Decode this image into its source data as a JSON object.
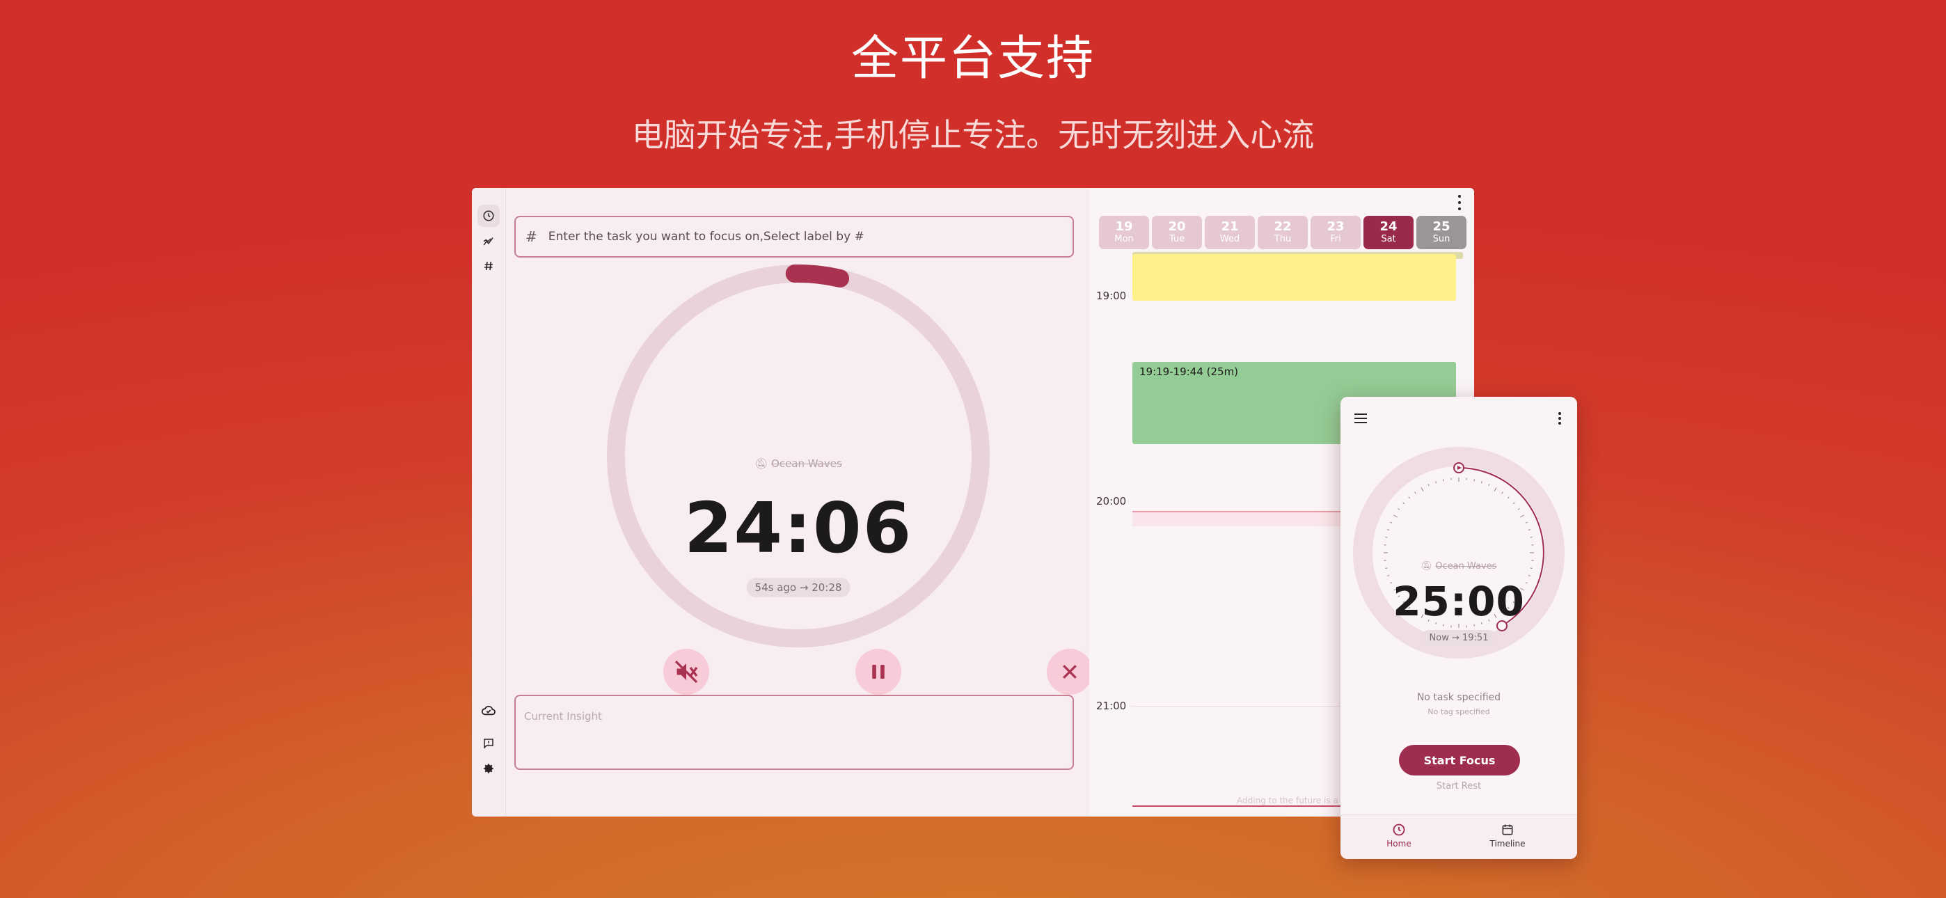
{
  "hero": {
    "title": "全平台支持",
    "subtitle": "电脑开始专注,手机停止专注。无时无刻进入心流"
  },
  "desktop": {
    "sidebar": {
      "items": [
        {
          "name": "timer",
          "icon": "clock-icon"
        },
        {
          "name": "stats",
          "icon": "chart-icon"
        },
        {
          "name": "tags",
          "icon": "hash-icon"
        }
      ],
      "bottom_items": [
        {
          "name": "sync",
          "icon": "cloud-icon"
        },
        {
          "name": "feedback",
          "icon": "feedback-icon"
        },
        {
          "name": "settings",
          "icon": "gear-icon"
        }
      ]
    },
    "task_input": {
      "placeholder": "Enter the task you want to focus on,Select label by #"
    },
    "timer": {
      "sound": "Ocean Waves",
      "time": "24:06",
      "chip": "54s ago → 20:28",
      "progress": 0.04
    },
    "controls": {
      "mute_icon": "volume-off-icon",
      "pause_icon": "pause-icon",
      "stop_icon": "close-icon"
    },
    "insight": {
      "placeholder": "Current Insight"
    },
    "timeline": {
      "days": [
        {
          "num": "19",
          "wd": "Mon"
        },
        {
          "num": "20",
          "wd": "Tue"
        },
        {
          "num": "21",
          "wd": "Wed"
        },
        {
          "num": "22",
          "wd": "Thu"
        },
        {
          "num": "23",
          "wd": "Fri"
        },
        {
          "num": "24",
          "wd": "Sat"
        },
        {
          "num": "25",
          "wd": "Sun"
        }
      ],
      "hours": [
        "19:00",
        "20:00",
        "21:00"
      ],
      "event_green": "19:19-19:44 (25m)",
      "future_hint": "Adding to the future is a"
    }
  },
  "phone": {
    "timer": {
      "sound": "Ocean Waves",
      "time": "25:00",
      "chip": "Now → 19:51"
    },
    "no_task": "No task specified",
    "no_tag": "No tag specified",
    "start_focus": "Start Focus",
    "start_rest": "Start Rest",
    "nav": {
      "home": "Home",
      "timeline": "Timeline"
    }
  },
  "colors": {
    "accent": "#9e2d4f",
    "ring_track": "#ead2da",
    "event_yellow": "#fff08a",
    "event_green": "#93cc94"
  }
}
